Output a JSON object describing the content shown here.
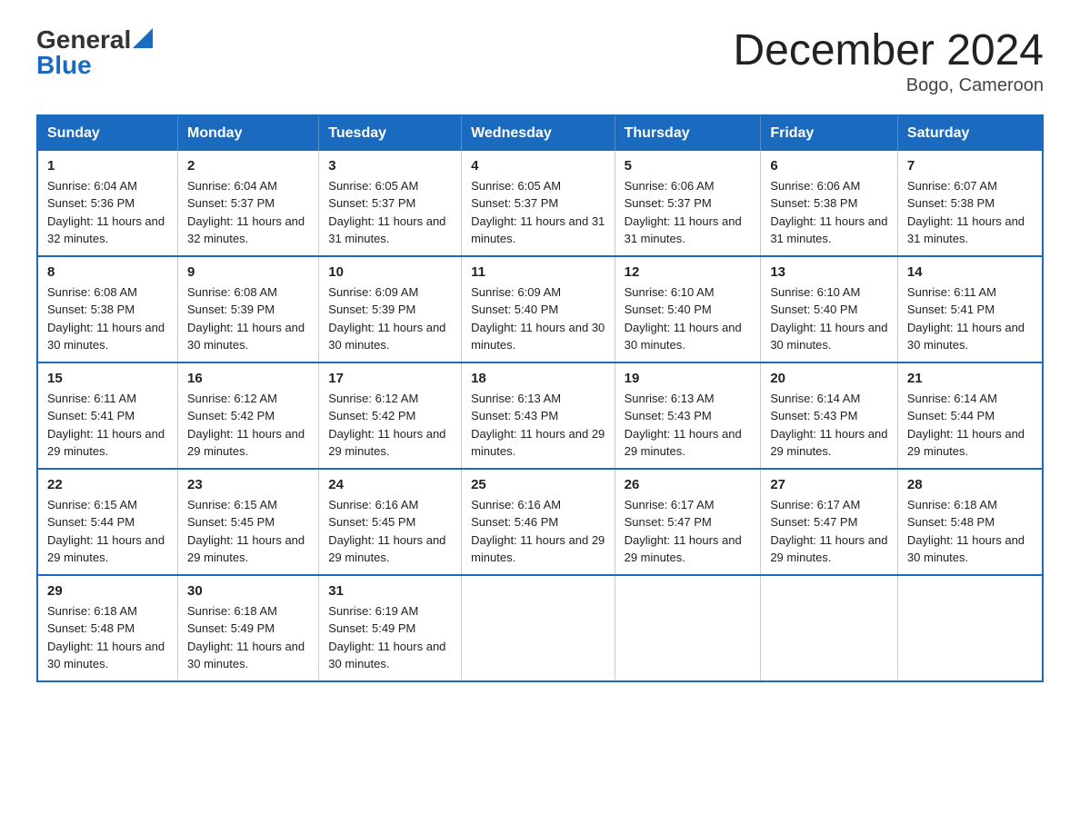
{
  "logo": {
    "general": "General",
    "blue": "Blue"
  },
  "title": "December 2024",
  "subtitle": "Bogo, Cameroon",
  "headers": [
    "Sunday",
    "Monday",
    "Tuesday",
    "Wednesday",
    "Thursday",
    "Friday",
    "Saturday"
  ],
  "weeks": [
    [
      {
        "day": "1",
        "sunrise": "6:04 AM",
        "sunset": "5:36 PM",
        "daylight": "11 hours and 32 minutes."
      },
      {
        "day": "2",
        "sunrise": "6:04 AM",
        "sunset": "5:37 PM",
        "daylight": "11 hours and 32 minutes."
      },
      {
        "day": "3",
        "sunrise": "6:05 AM",
        "sunset": "5:37 PM",
        "daylight": "11 hours and 31 minutes."
      },
      {
        "day": "4",
        "sunrise": "6:05 AM",
        "sunset": "5:37 PM",
        "daylight": "11 hours and 31 minutes."
      },
      {
        "day": "5",
        "sunrise": "6:06 AM",
        "sunset": "5:37 PM",
        "daylight": "11 hours and 31 minutes."
      },
      {
        "day": "6",
        "sunrise": "6:06 AM",
        "sunset": "5:38 PM",
        "daylight": "11 hours and 31 minutes."
      },
      {
        "day": "7",
        "sunrise": "6:07 AM",
        "sunset": "5:38 PM",
        "daylight": "11 hours and 31 minutes."
      }
    ],
    [
      {
        "day": "8",
        "sunrise": "6:08 AM",
        "sunset": "5:38 PM",
        "daylight": "11 hours and 30 minutes."
      },
      {
        "day": "9",
        "sunrise": "6:08 AM",
        "sunset": "5:39 PM",
        "daylight": "11 hours and 30 minutes."
      },
      {
        "day": "10",
        "sunrise": "6:09 AM",
        "sunset": "5:39 PM",
        "daylight": "11 hours and 30 minutes."
      },
      {
        "day": "11",
        "sunrise": "6:09 AM",
        "sunset": "5:40 PM",
        "daylight": "11 hours and 30 minutes."
      },
      {
        "day": "12",
        "sunrise": "6:10 AM",
        "sunset": "5:40 PM",
        "daylight": "11 hours and 30 minutes."
      },
      {
        "day": "13",
        "sunrise": "6:10 AM",
        "sunset": "5:40 PM",
        "daylight": "11 hours and 30 minutes."
      },
      {
        "day": "14",
        "sunrise": "6:11 AM",
        "sunset": "5:41 PM",
        "daylight": "11 hours and 30 minutes."
      }
    ],
    [
      {
        "day": "15",
        "sunrise": "6:11 AM",
        "sunset": "5:41 PM",
        "daylight": "11 hours and 29 minutes."
      },
      {
        "day": "16",
        "sunrise": "6:12 AM",
        "sunset": "5:42 PM",
        "daylight": "11 hours and 29 minutes."
      },
      {
        "day": "17",
        "sunrise": "6:12 AM",
        "sunset": "5:42 PM",
        "daylight": "11 hours and 29 minutes."
      },
      {
        "day": "18",
        "sunrise": "6:13 AM",
        "sunset": "5:43 PM",
        "daylight": "11 hours and 29 minutes."
      },
      {
        "day": "19",
        "sunrise": "6:13 AM",
        "sunset": "5:43 PM",
        "daylight": "11 hours and 29 minutes."
      },
      {
        "day": "20",
        "sunrise": "6:14 AM",
        "sunset": "5:43 PM",
        "daylight": "11 hours and 29 minutes."
      },
      {
        "day": "21",
        "sunrise": "6:14 AM",
        "sunset": "5:44 PM",
        "daylight": "11 hours and 29 minutes."
      }
    ],
    [
      {
        "day": "22",
        "sunrise": "6:15 AM",
        "sunset": "5:44 PM",
        "daylight": "11 hours and 29 minutes."
      },
      {
        "day": "23",
        "sunrise": "6:15 AM",
        "sunset": "5:45 PM",
        "daylight": "11 hours and 29 minutes."
      },
      {
        "day": "24",
        "sunrise": "6:16 AM",
        "sunset": "5:45 PM",
        "daylight": "11 hours and 29 minutes."
      },
      {
        "day": "25",
        "sunrise": "6:16 AM",
        "sunset": "5:46 PM",
        "daylight": "11 hours and 29 minutes."
      },
      {
        "day": "26",
        "sunrise": "6:17 AM",
        "sunset": "5:47 PM",
        "daylight": "11 hours and 29 minutes."
      },
      {
        "day": "27",
        "sunrise": "6:17 AM",
        "sunset": "5:47 PM",
        "daylight": "11 hours and 29 minutes."
      },
      {
        "day": "28",
        "sunrise": "6:18 AM",
        "sunset": "5:48 PM",
        "daylight": "11 hours and 30 minutes."
      }
    ],
    [
      {
        "day": "29",
        "sunrise": "6:18 AM",
        "sunset": "5:48 PM",
        "daylight": "11 hours and 30 minutes."
      },
      {
        "day": "30",
        "sunrise": "6:18 AM",
        "sunset": "5:49 PM",
        "daylight": "11 hours and 30 minutes."
      },
      {
        "day": "31",
        "sunrise": "6:19 AM",
        "sunset": "5:49 PM",
        "daylight": "11 hours and 30 minutes."
      },
      null,
      null,
      null,
      null
    ]
  ]
}
